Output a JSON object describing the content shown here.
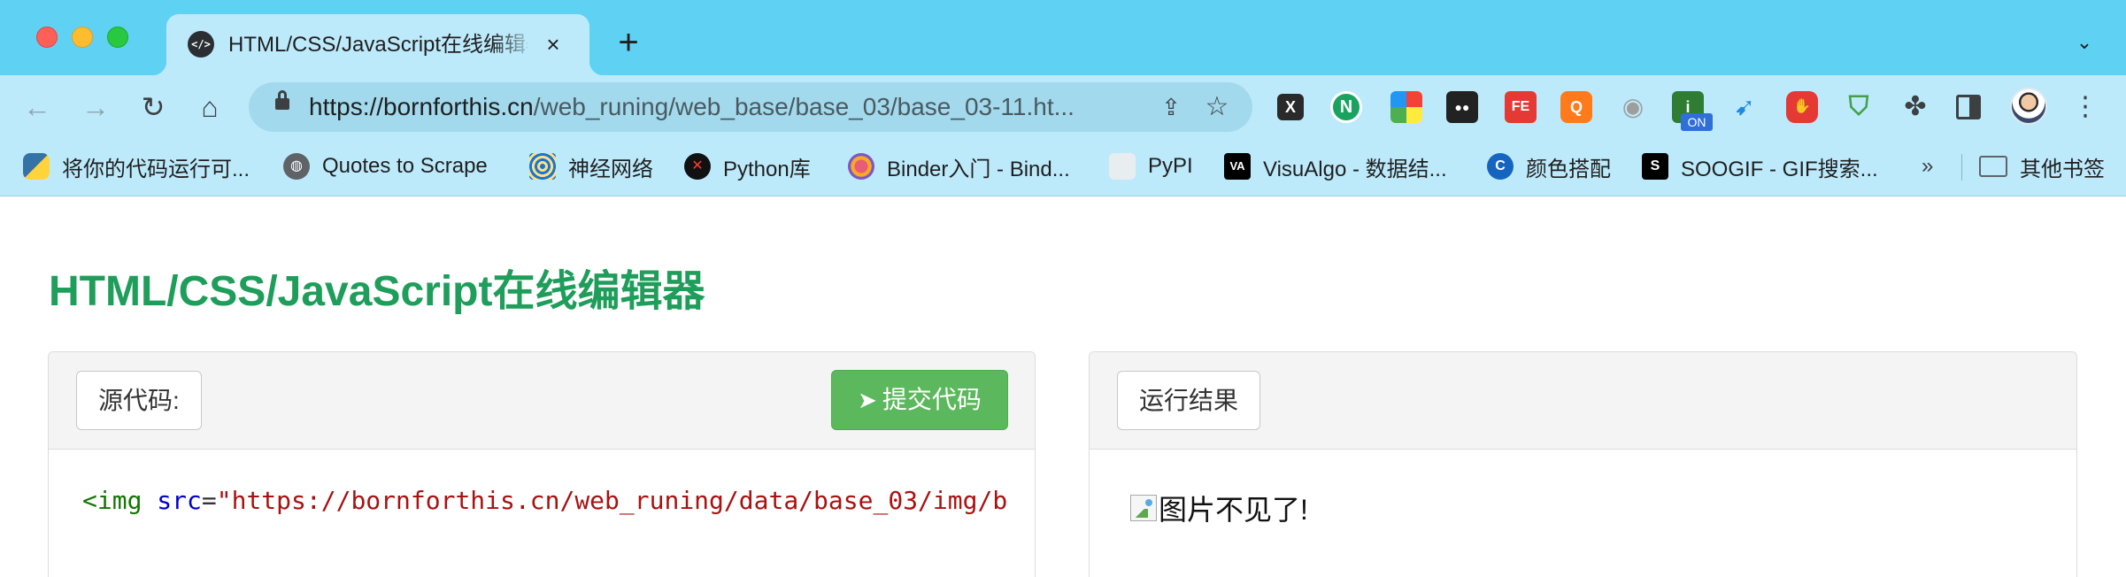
{
  "browser": {
    "tab": {
      "favicon": "</>",
      "title": "HTML/CSS/JavaScript在线编辑器",
      "close_icon": "×"
    },
    "new_tab_icon": "+",
    "tab_menu_icon": "⌄",
    "address": {
      "url_domain": "https://bornforthis.cn",
      "url_path": "/web_runing/web_base/base_03/base_03-11.ht..."
    },
    "extensions": [
      {
        "name": "x-extension",
        "text": "X"
      },
      {
        "name": "nodejs-extension",
        "text": "N"
      },
      {
        "name": "color-grid-extension",
        "text": ""
      },
      {
        "name": "eyes-extension",
        "text": "●●"
      },
      {
        "name": "fe-extension",
        "text": "FE"
      },
      {
        "name": "orange-extension",
        "text": "Q"
      },
      {
        "name": "camera-extension",
        "text": "📷"
      },
      {
        "name": "on-extension",
        "text": "i",
        "badge": "ON"
      },
      {
        "name": "bird-extension",
        "text": "🐦"
      },
      {
        "name": "stop-extension",
        "text": "✋"
      },
      {
        "name": "shield-extension",
        "text": "✓"
      },
      {
        "name": "puzzle-extension",
        "text": "✤"
      }
    ]
  },
  "bookmarks": {
    "items": [
      {
        "label": "将你的代码运行可...",
        "icon": "python-icon"
      },
      {
        "label": "Quotes to Scrape",
        "icon": "globe-icon"
      },
      {
        "label": "神经网络",
        "icon": "spiral-icon"
      },
      {
        "label": "Python库",
        "icon": "red-x-icon"
      },
      {
        "label": "Binder入门 - Bind...",
        "icon": "binder-icon"
      },
      {
        "label": "PyPI",
        "icon": "cube-icon"
      },
      {
        "label": "VisuAlgo - 数据结...",
        "icon": "visualgo-icon"
      },
      {
        "label": "颜色搭配",
        "icon": "c-icon"
      },
      {
        "label": "SOOGIF - GIF搜索...",
        "icon": "soogif-icon"
      }
    ],
    "more": "»",
    "folder": "其他书签"
  },
  "page": {
    "title": "HTML/CSS/JavaScript在线编辑器",
    "source_label": "源代码:",
    "submit_button": "提交代码",
    "result_label": "运行结果",
    "code": {
      "open": "<img",
      "attr": "src",
      "eq": "=",
      "value": "\"https://bornforthis.cn/web_runing/data/base_03/img/b"
    },
    "result_alt_text": "图片不见了!"
  }
}
